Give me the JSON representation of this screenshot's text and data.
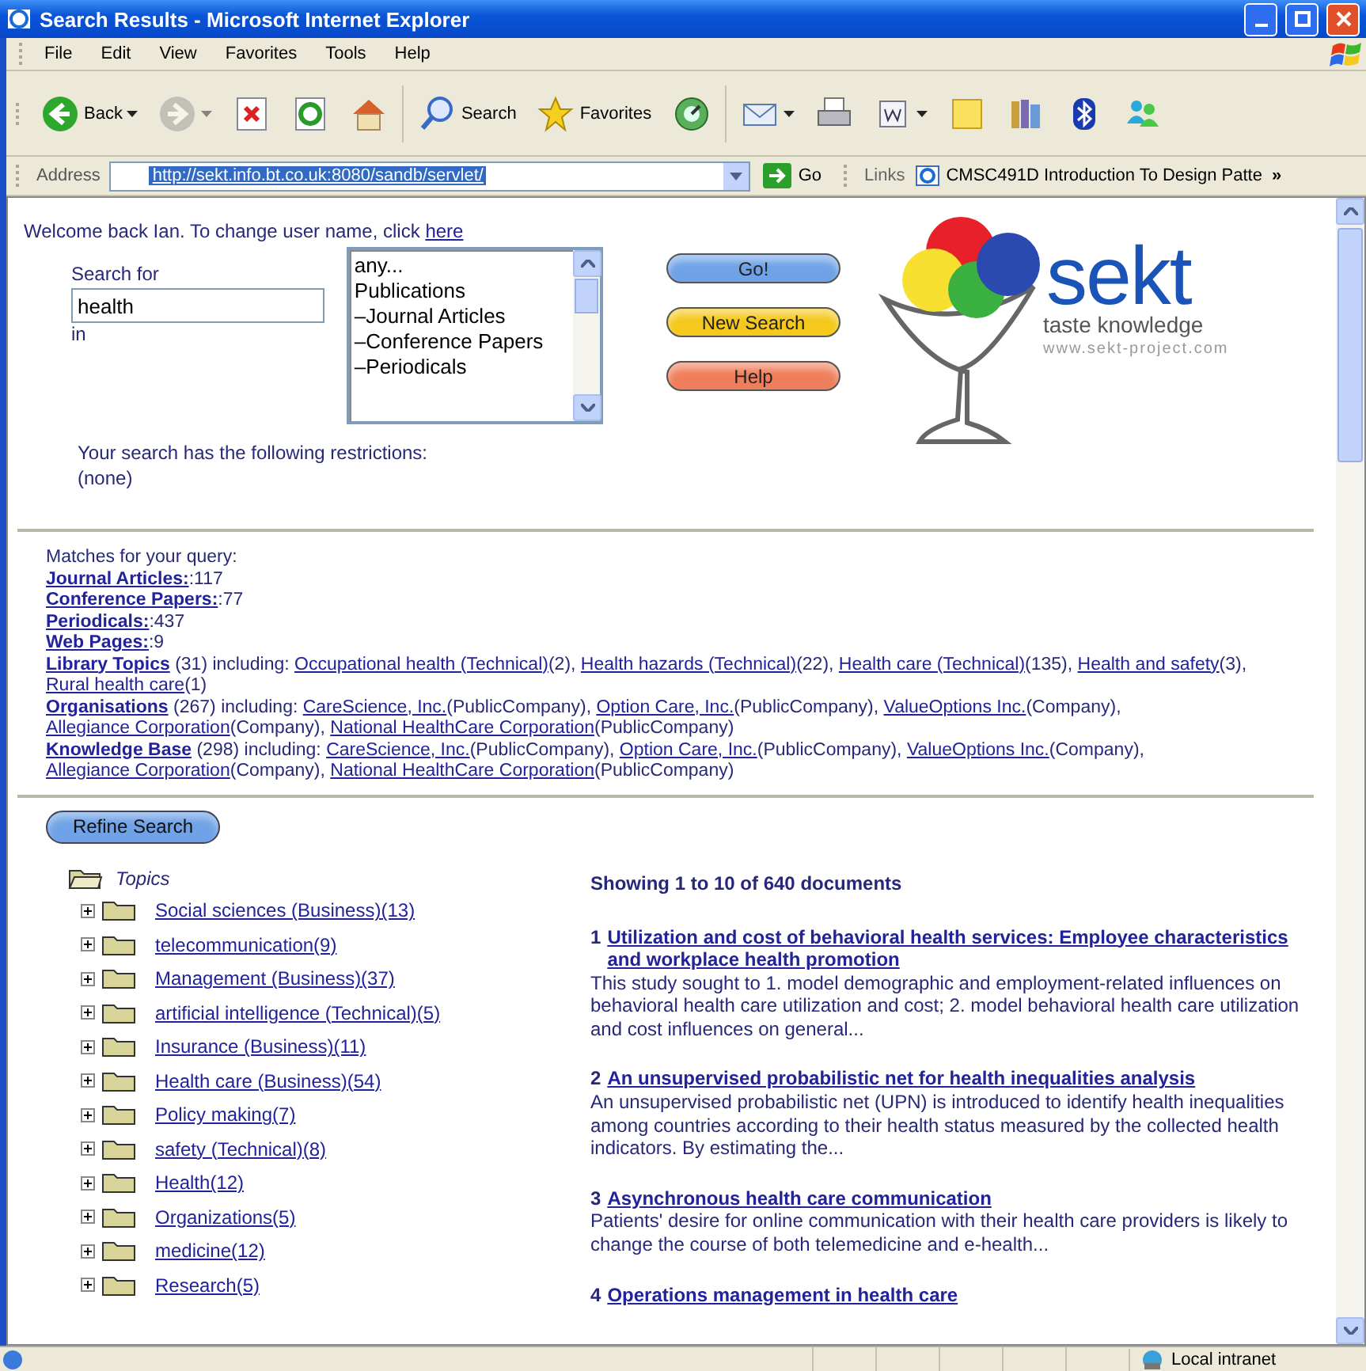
{
  "window": {
    "title": "Search Results - Microsoft Internet Explorer"
  },
  "menu_bar": [
    "File",
    "Edit",
    "View",
    "Favorites",
    "Tools",
    "Help"
  ],
  "toolbar": [
    {
      "label": "Back",
      "dropdown": true,
      "disabled": false
    },
    {
      "dropdown": true,
      "disabled": true
    },
    {
      "dropdown": false,
      "disabled": false
    },
    {
      "dropdown": false,
      "disabled": false
    },
    {
      "dropdown": false,
      "disabled": false
    },
    {
      "label": "Search",
      "dropdown": false,
      "disabled": false
    },
    {
      "label": "Favorites",
      "dropdown": false,
      "disabled": false
    },
    {
      "dropdown": false,
      "disabled": false
    },
    {
      "dropdown": true,
      "disabled": false
    },
    {
      "dropdown": false,
      "disabled": false
    },
    {
      "dropdown": true,
      "disabled": false
    },
    {
      "dropdown": false,
      "disabled": false
    },
    {
      "dropdown": false,
      "disabled": false
    },
    {
      "dropdown": false,
      "disabled": false
    },
    {
      "dropdown": false,
      "disabled": false
    }
  ],
  "address_bar": {
    "label": "Address",
    "url": "http://sekt.info.bt.co.uk:8080/sandb/servlet/",
    "go": "Go",
    "links_label": "Links",
    "link": "CMSC491D Introduction To Design Patte",
    "more": "»"
  },
  "page": {
    "welcome": {
      "text": "Welcome back Ian. To change user name, click",
      "link": "here"
    },
    "search": {
      "label": "Search for",
      "value": "health",
      "in_label": "in",
      "options": [
        {
          "label": "any...",
          "selected": false
        },
        {
          "label": "Publications",
          "selected": false
        },
        {
          "label": "–Journal Articles",
          "selected": false
        },
        {
          "label": "–Conference Papers",
          "selected": false
        },
        {
          "label": "–Periodicals",
          "selected": false
        }
      ],
      "buttons": [
        {
          "label": "Go!",
          "color": "#6fa2e6"
        },
        {
          "label": "New Search",
          "color": "#f4c81c"
        },
        {
          "label": "Help",
          "color": "#ef7f5c"
        }
      ],
      "restrictions": "Your search has the following restrictions:",
      "restrictions_value": "(none)"
    },
    "logo": {
      "name": "sekt",
      "tagline": "taste knowledge",
      "url": "www.sekt-project.com"
    },
    "matches": {
      "heading": "Matches for your query:",
      "counts": [
        {
          "link": "Journal Articles:",
          "count": ":117"
        },
        {
          "link": "Conference Papers:",
          "count": ":77"
        },
        {
          "link": "Periodicals:",
          "count": ":437"
        },
        {
          "link": "Web Pages:",
          "count": ":9"
        }
      ],
      "groups": [
        {
          "link": "Library Topics",
          "count": "(31) including:",
          "items": [
            {
              "link": "Occupational health (Technical)",
              "after": "(2),"
            },
            {
              "link": "Health hazards (Technical)",
              "after": "(22),"
            },
            {
              "link": "Health care (Technical)",
              "after": "(135),"
            },
            {
              "link": "Health and safety",
              "after": "(3),"
            },
            {
              "link": "Rural health care",
              "after": "(1)"
            }
          ]
        },
        {
          "link": "Organisations",
          "count": "(267) including:",
          "items": [
            {
              "link": "CareScience, Inc.",
              "after": "(PublicCompany),"
            },
            {
              "link": "Option Care, Inc.",
              "after": "(PublicCompany),"
            },
            {
              "link": "ValueOptions Inc.",
              "after": "(Company),"
            },
            {
              "link": "Allegiance Corporation",
              "after": "(Company),"
            },
            {
              "link": "National HealthCare Corporation",
              "after": "(PublicCompany)"
            }
          ]
        },
        {
          "link": "Knowledge Base",
          "count": "(298) including:",
          "items": [
            {
              "link": "CareScience, Inc.",
              "after": "(PublicCompany),"
            },
            {
              "link": "Option Care, Inc.",
              "after": "(PublicCompany),"
            },
            {
              "link": "ValueOptions Inc.",
              "after": "(Company),"
            },
            {
              "link": "Allegiance Corporation",
              "after": "(Company),"
            },
            {
              "link": "National HealthCare Corporation",
              "after": "(PublicCompany)"
            }
          ]
        }
      ]
    },
    "refine": "Refine Search",
    "tree": {
      "label": "Topics",
      "children": [
        {
          "label": "Social sciences (Business)(13)",
          "expanded": false
        },
        {
          "label": "telecommunication(9)",
          "expanded": false
        },
        {
          "label": "Management (Business)(37)",
          "expanded": false
        },
        {
          "label": "artificial intelligence (Technical)(5)",
          "expanded": false
        },
        {
          "label": "Insurance (Business)(11)",
          "expanded": false
        },
        {
          "label": "Health care (Business)(54)",
          "expanded": false
        },
        {
          "label": "Policy making(7)",
          "expanded": false
        },
        {
          "label": "safety (Technical)(8)",
          "expanded": false
        },
        {
          "label": "Health(12)",
          "expanded": false
        },
        {
          "label": "Organizations(5)",
          "expanded": false
        },
        {
          "label": "medicine(12)",
          "expanded": false
        },
        {
          "label": "Research(5)",
          "expanded": false
        }
      ]
    },
    "results": {
      "heading": "Showing 1 to 10 of 640 documents",
      "items": [
        {
          "number": "1",
          "title": "Utilization and cost of behavioral health services: Employee characteristics and workplace health promotion",
          "snippet": "This study sought to 1. model demographic and employment-related influences on behavioral health care utilization and cost; 2. model behavioral health care utilization and cost influences on general..."
        },
        {
          "number": "2",
          "title": "An unsupervised probabilistic net for health inequalities analysis",
          "snippet": "An unsupervised probabilistic net (UPN) is introduced to identify health inequalities among countries according to their health status measured by the collected health indicators. By estimating the..."
        },
        {
          "number": "3",
          "title": "Asynchronous health care communication",
          "snippet": "Patients' desire for online communication with their health care providers is likely to change the course of both telemedicine and e-health..."
        },
        {
          "number": "4",
          "title": "Operations management in health care"
        }
      ]
    }
  },
  "status_bar": {
    "zone": "Local intranet"
  }
}
